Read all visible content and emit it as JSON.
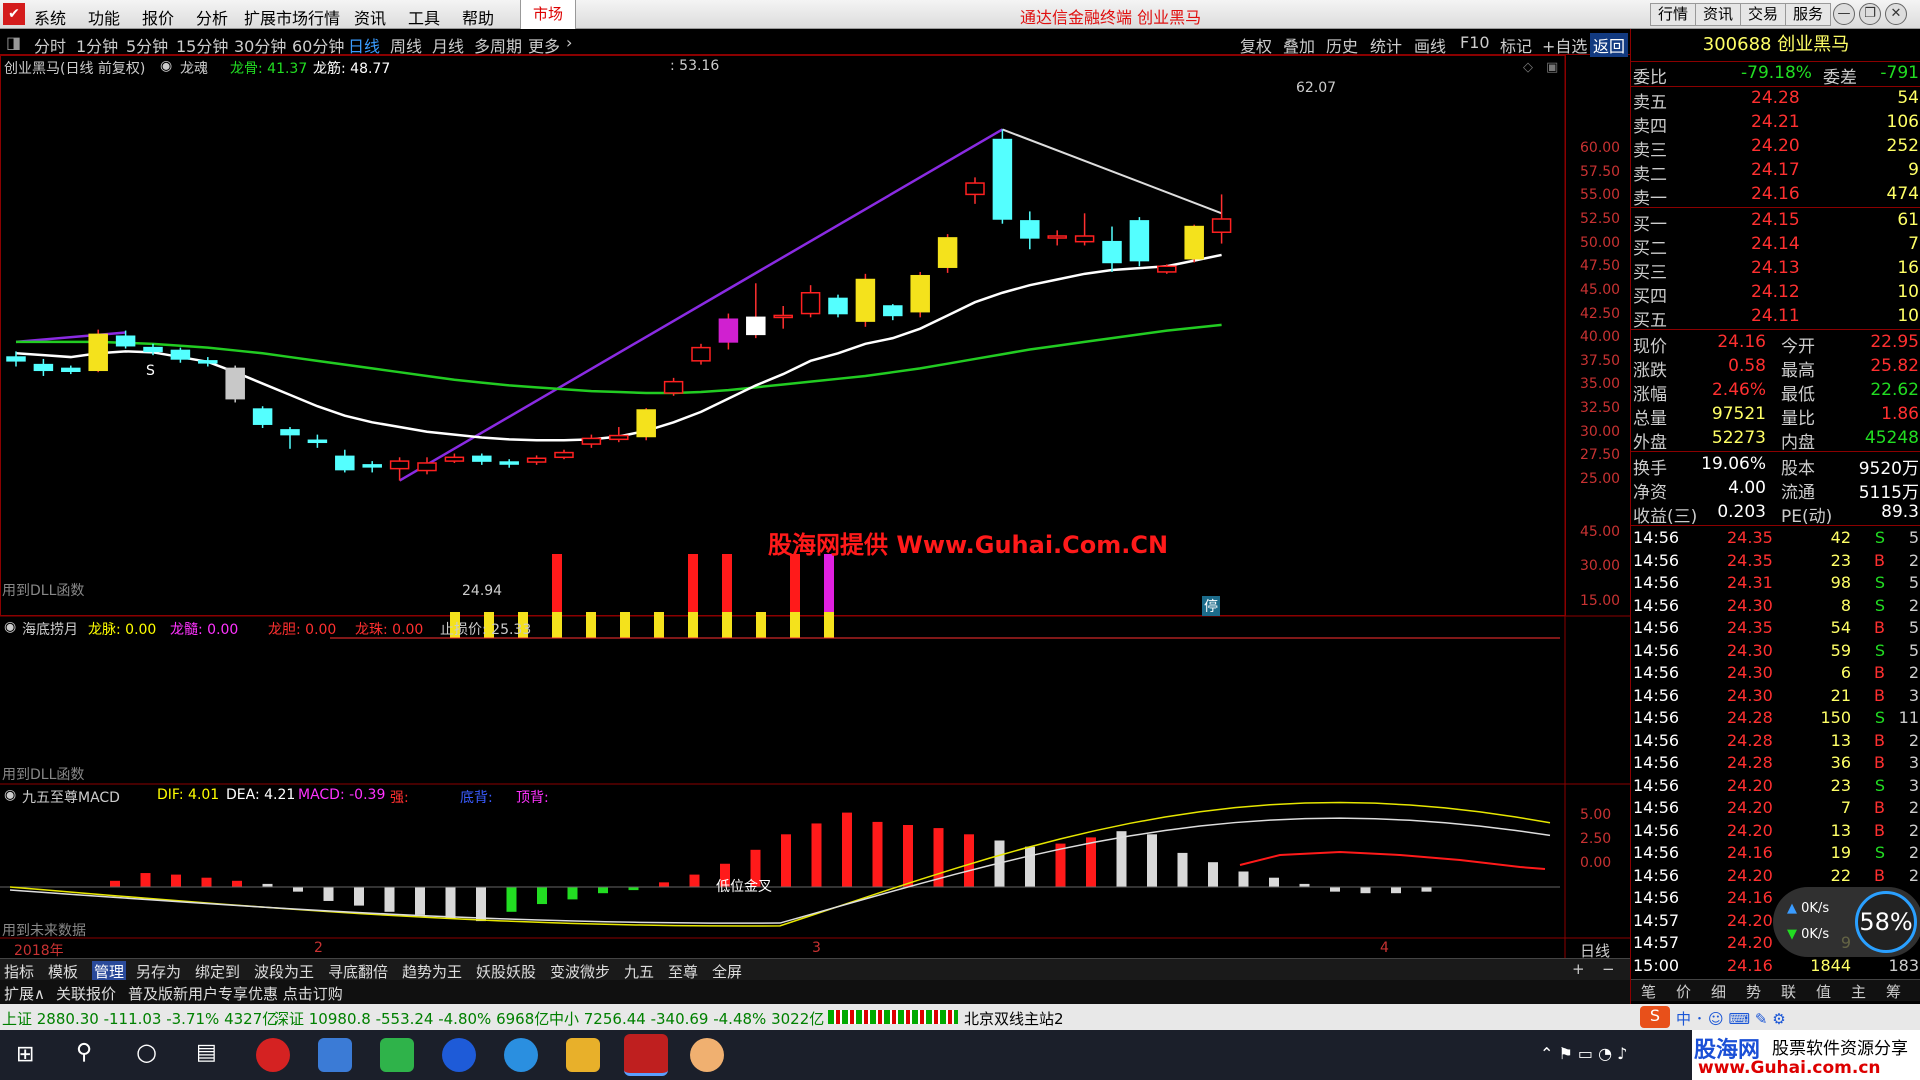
{
  "menubar": {
    "items": [
      "系统",
      "功能",
      "报价",
      "分析",
      "扩展市场行情",
      "资讯",
      "工具",
      "帮助"
    ],
    "market_tab": "市场",
    "title": "通达信金融终端 创业黑马",
    "right_buttons": [
      "行情",
      "资讯",
      "交易",
      "服务"
    ]
  },
  "periods": [
    "分时",
    "1分钟",
    "5分钟",
    "15分钟",
    "30分钟",
    "60分钟",
    "日线",
    "周线",
    "月线",
    "多周期",
    "更多"
  ],
  "active_period": "日线",
  "tools": [
    "复权",
    "叠加",
    "历史",
    "统计",
    "画线",
    "F10",
    "标记",
    "+自选",
    "返回"
  ],
  "main_chart": {
    "header_name": "创业黑马(日线 前复权)",
    "header_indicator": "龙魂",
    "long_gu": "龙骨: 41.37",
    "long_jin": "龙筋: 48.77",
    "cursor_value": ": 53.16",
    "high_label": "62.07",
    "low_label": "24.94",
    "marker_s": "S",
    "watermark": "股海网提供 Www.Guhai.Com.CN",
    "dll_note": "用到DLL函数",
    "stop_badge": "停",
    "y_ticks": [
      "60.00",
      "57.50",
      "55.00",
      "52.50",
      "50.00",
      "47.50",
      "45.00",
      "42.50",
      "40.00",
      "37.50",
      "35.00",
      "32.50",
      "30.00",
      "27.50",
      "25.00"
    ]
  },
  "sub1": {
    "name": "海底捞月",
    "long_mai": "龙脉: 0.00",
    "long_sui": "龙髓: 0.00",
    "long_dan": "龙胆: 0.00",
    "long_zhu": "龙珠: 0.00",
    "stop_price": "止损价: 25.33",
    "dll_note": "用到DLL函数",
    "y_ticks": [
      "45.00",
      "30.00",
      "15.00"
    ]
  },
  "sub2": {
    "name": "九五至尊MACD",
    "dif": "DIF: 4.01",
    "dea": "DEA: 4.21",
    "macd": "MACD: -0.39",
    "extra1": "强:",
    "extra2": "底背:",
    "extra3": "顶背:",
    "low_cross": "低位金叉",
    "future_note": "用到未来数据",
    "y_ticks": [
      "5.00",
      "2.50",
      "0.00"
    ]
  },
  "time_axis": {
    "year": "2018年",
    "months": [
      "2",
      "3",
      "4"
    ],
    "period_label": "日线"
  },
  "chart_data": {
    "type": "candlestick",
    "symbol": "创业黑马",
    "ylim": [
      24,
      63
    ],
    "high": 62.07,
    "low": 24.94,
    "candles": [
      {
        "o": 38.0,
        "c": 37.6,
        "h": 38.6,
        "l": 37.0
      },
      {
        "o": 37.2,
        "c": 36.6,
        "h": 37.8,
        "l": 36.0
      },
      {
        "o": 36.8,
        "c": 36.5,
        "h": 37.1,
        "l": 36.2
      },
      {
        "o": 36.6,
        "c": 40.4,
        "h": 40.9,
        "l": 36.4
      },
      {
        "o": 40.2,
        "c": 39.2,
        "h": 40.8,
        "l": 38.9
      },
      {
        "o": 39.0,
        "c": 38.6,
        "h": 39.4,
        "l": 38.2
      },
      {
        "o": 38.7,
        "c": 37.8,
        "h": 39.0,
        "l": 37.4
      },
      {
        "o": 37.6,
        "c": 37.5,
        "h": 38.0,
        "l": 37.0
      },
      {
        "o": 36.8,
        "c": 33.6,
        "h": 37.1,
        "l": 33.2
      },
      {
        "o": 32.5,
        "c": 30.9,
        "h": 32.8,
        "l": 30.5
      },
      {
        "o": 30.3,
        "c": 29.8,
        "h": 30.6,
        "l": 28.3
      },
      {
        "o": 29.2,
        "c": 29.0,
        "h": 29.8,
        "l": 28.4
      },
      {
        "o": 27.5,
        "c": 26.1,
        "h": 28.2,
        "l": 25.8
      },
      {
        "o": 26.6,
        "c": 26.5,
        "h": 27.0,
        "l": 25.8
      },
      {
        "o": 26.2,
        "c": 27.0,
        "h": 27.4,
        "l": 24.94
      },
      {
        "o": 26.0,
        "c": 26.8,
        "h": 27.4,
        "l": 25.6
      },
      {
        "o": 27.0,
        "c": 27.4,
        "h": 27.8,
        "l": 26.8
      },
      {
        "o": 27.5,
        "c": 27.0,
        "h": 27.8,
        "l": 26.6
      },
      {
        "o": 26.9,
        "c": 26.8,
        "h": 27.2,
        "l": 26.3
      },
      {
        "o": 26.9,
        "c": 27.3,
        "h": 27.6,
        "l": 26.6
      },
      {
        "o": 27.4,
        "c": 27.9,
        "h": 28.2,
        "l": 27.2
      },
      {
        "o": 28.8,
        "c": 29.4,
        "h": 29.8,
        "l": 28.4
      },
      {
        "o": 29.3,
        "c": 29.7,
        "h": 30.6,
        "l": 29.0
      },
      {
        "o": 29.6,
        "c": 32.4,
        "h": 32.6,
        "l": 29.2
      },
      {
        "o": 34.2,
        "c": 35.4,
        "h": 35.8,
        "l": 33.9
      },
      {
        "o": 37.6,
        "c": 39.0,
        "h": 39.4,
        "l": 37.2
      },
      {
        "o": 39.6,
        "c": 42.0,
        "h": 42.6,
        "l": 38.8
      },
      {
        "o": 40.4,
        "c": 42.2,
        "h": 45.8,
        "l": 40.0
      },
      {
        "o": 42.2,
        "c": 42.4,
        "h": 43.4,
        "l": 41.0
      },
      {
        "o": 42.6,
        "c": 44.8,
        "h": 45.6,
        "l": 42.2
      },
      {
        "o": 44.2,
        "c": 42.6,
        "h": 44.6,
        "l": 42.2
      },
      {
        "o": 41.8,
        "c": 46.2,
        "h": 46.8,
        "l": 41.2
      },
      {
        "o": 43.4,
        "c": 42.4,
        "h": 43.6,
        "l": 41.9
      },
      {
        "o": 42.8,
        "c": 46.6,
        "h": 47.0,
        "l": 42.2
      },
      {
        "o": 47.5,
        "c": 50.6,
        "h": 51.0,
        "l": 46.9
      },
      {
        "o": 55.2,
        "c": 56.4,
        "h": 57.0,
        "l": 54.2
      },
      {
        "o": 61.0,
        "c": 52.6,
        "h": 62.07,
        "l": 52.1
      },
      {
        "o": 52.4,
        "c": 50.6,
        "h": 53.4,
        "l": 49.4
      },
      {
        "o": 50.6,
        "c": 50.8,
        "h": 51.4,
        "l": 49.8
      },
      {
        "o": 50.2,
        "c": 50.8,
        "h": 53.2,
        "l": 49.8
      },
      {
        "o": 50.2,
        "c": 48.0,
        "h": 51.8,
        "l": 47.0
      },
      {
        "o": 52.4,
        "c": 48.2,
        "h": 52.8,
        "l": 47.6
      },
      {
        "o": 47.0,
        "c": 47.6,
        "h": 47.8,
        "l": 46.8
      },
      {
        "o": 48.4,
        "c": 51.8,
        "h": 52.0,
        "l": 48.0
      },
      {
        "o": 51.2,
        "c": 52.6,
        "h": 55.2,
        "l": 50.0
      }
    ],
    "ma_white": [
      38.4,
      38.2,
      38.0,
      38.4,
      38.6,
      38.5,
      38.0,
      37.5,
      36.4,
      35.2,
      34.0,
      32.8,
      31.8,
      31.1,
      30.6,
      30.1,
      29.8,
      29.5,
      29.3,
      29.2,
      29.2,
      29.3,
      29.6,
      30.2,
      31.1,
      32.2,
      33.6,
      35.0,
      36.2,
      37.6,
      38.4,
      39.4,
      40.0,
      41.0,
      42.4,
      43.8,
      44.8,
      45.6,
      46.2,
      46.8,
      47.2,
      47.4,
      47.6,
      48.2,
      48.8
    ],
    "ma_green": [
      39.6,
      39.6,
      39.6,
      39.6,
      39.5,
      39.4,
      39.2,
      39.0,
      38.7,
      38.4,
      38.0,
      37.6,
      37.2,
      36.8,
      36.4,
      36.0,
      35.6,
      35.3,
      35.0,
      34.8,
      34.6,
      34.4,
      34.3,
      34.2,
      34.2,
      34.3,
      34.5,
      34.8,
      35.1,
      35.4,
      35.7,
      36.0,
      36.4,
      36.8,
      37.3,
      37.8,
      38.3,
      38.8,
      39.2,
      39.6,
      40.0,
      40.4,
      40.8,
      41.1,
      41.4
    ]
  },
  "right_panel": {
    "code": "300688",
    "name": "创业黑马",
    "weibi_label": "委比",
    "weibi": "-79.18%",
    "weicha_label": "委差",
    "weicha": "-791",
    "asks": [
      {
        "label": "卖五",
        "price": "24.28",
        "vol": "54"
      },
      {
        "label": "卖四",
        "price": "24.21",
        "vol": "106"
      },
      {
        "label": "卖三",
        "price": "24.20",
        "vol": "252"
      },
      {
        "label": "卖二",
        "price": "24.17",
        "vol": "9"
      },
      {
        "label": "卖一",
        "price": "24.16",
        "vol": "474"
      }
    ],
    "bids": [
      {
        "label": "买一",
        "price": "24.15",
        "vol": "61"
      },
      {
        "label": "买二",
        "price": "24.14",
        "vol": "7"
      },
      {
        "label": "买三",
        "price": "24.13",
        "vol": "16"
      },
      {
        "label": "买四",
        "price": "24.12",
        "vol": "10"
      },
      {
        "label": "买五",
        "price": "24.11",
        "vol": "10"
      }
    ],
    "quotes": [
      {
        "l1": "现价",
        "v1": "24.16",
        "l2": "今开",
        "v2": "22.95"
      },
      {
        "l1": "涨跌",
        "v1": "0.58",
        "l2": "最高",
        "v2": "25.82"
      },
      {
        "l1": "涨幅",
        "v1": "2.46%",
        "l2": "最低",
        "v2": "22.62"
      },
      {
        "l1": "总量",
        "v1": "97521",
        "l2": "量比",
        "v2": "1.86"
      },
      {
        "l1": "外盘",
        "v1": "52273",
        "l2": "内盘",
        "v2": "45248"
      }
    ],
    "fundamentals": [
      {
        "l1": "换手",
        "v1": "19.06%",
        "l2": "股本",
        "v2": "9520万"
      },
      {
        "l1": "净资",
        "v1": "4.00",
        "l2": "流通",
        "v2": "5115万"
      },
      {
        "l1": "收益(三)",
        "v1": "0.203",
        "l2": "PE(动)",
        "v2": "89.3"
      }
    ],
    "ticks": [
      {
        "t": "14:56",
        "p": "24.35",
        "v": "42",
        "bs": "S",
        "n": "5"
      },
      {
        "t": "14:56",
        "p": "24.35",
        "v": "23",
        "bs": "B",
        "n": "2"
      },
      {
        "t": "14:56",
        "p": "24.31",
        "v": "98",
        "bs": "S",
        "n": "5"
      },
      {
        "t": "14:56",
        "p": "24.30",
        "v": "8",
        "bs": "S",
        "n": "2"
      },
      {
        "t": "14:56",
        "p": "24.35",
        "v": "54",
        "bs": "B",
        "n": "5"
      },
      {
        "t": "14:56",
        "p": "24.30",
        "v": "59",
        "bs": "S",
        "n": "5"
      },
      {
        "t": "14:56",
        "p": "24.30",
        "v": "6",
        "bs": "B",
        "n": "2"
      },
      {
        "t": "14:56",
        "p": "24.30",
        "v": "21",
        "bs": "B",
        "n": "3"
      },
      {
        "t": "14:56",
        "p": "24.28",
        "v": "150",
        "bs": "S",
        "n": "11"
      },
      {
        "t": "14:56",
        "p": "24.28",
        "v": "13",
        "bs": "B",
        "n": "2"
      },
      {
        "t": "14:56",
        "p": "24.28",
        "v": "36",
        "bs": "B",
        "n": "3"
      },
      {
        "t": "14:56",
        "p": "24.20",
        "v": "23",
        "bs": "S",
        "n": "3"
      },
      {
        "t": "14:56",
        "p": "24.20",
        "v": "7",
        "bs": "B",
        "n": "2"
      },
      {
        "t": "14:56",
        "p": "24.20",
        "v": "13",
        "bs": "B",
        "n": "2"
      },
      {
        "t": "14:56",
        "p": "24.16",
        "v": "19",
        "bs": "S",
        "n": "2"
      },
      {
        "t": "14:56",
        "p": "24.20",
        "v": "22",
        "bs": "B",
        "n": "2"
      },
      {
        "t": "14:56",
        "p": "24.16",
        "v": "",
        "bs": "",
        "n": ""
      },
      {
        "t": "14:57",
        "p": "24.20",
        "v": "",
        "bs": "",
        "n": ""
      },
      {
        "t": "14:57",
        "p": "24.20",
        "v": "9",
        "bs": "",
        "n": ""
      },
      {
        "t": "15:00",
        "p": "24.16",
        "v": "1844",
        "bs": "",
        "n": "183"
      }
    ],
    "speed_up": "0K/s",
    "speed_down": "0K/s",
    "gauge": "58%",
    "bottom_tabs": [
      "笔",
      "价",
      "细",
      "势",
      "联",
      "值",
      "主",
      "筹"
    ]
  },
  "tabbar": [
    "指标",
    "模板",
    "管理",
    "另存为",
    "绑定到",
    "波段为王",
    "寻底翻倍",
    "趋势为王",
    "妖股妖股",
    "变波微步",
    "九五",
    "至尊",
    "全屏"
  ],
  "funcbar": [
    "扩展∧",
    "关联报价",
    "普及版新用户专享优惠 点击订购"
  ],
  "statusbar": {
    "sh": "上证 2880.30 -111.03 -3.71% 4327亿",
    "sz": "深证 10980.8 -553.24 -4.80% 6968亿",
    "zx": "中小 7256.44 -340.69 -4.48% 3022亿",
    "station": "北京双线主站2"
  },
  "watermark_brand": "股海网",
  "watermark_brand_sub": "股票软件资源分享",
  "watermark_url": "www.Guhai.com.cn",
  "colors": {
    "up": "#ff3030",
    "down": "#54ffff",
    "grid": "#8b0000",
    "accent": "#3a9cff"
  }
}
